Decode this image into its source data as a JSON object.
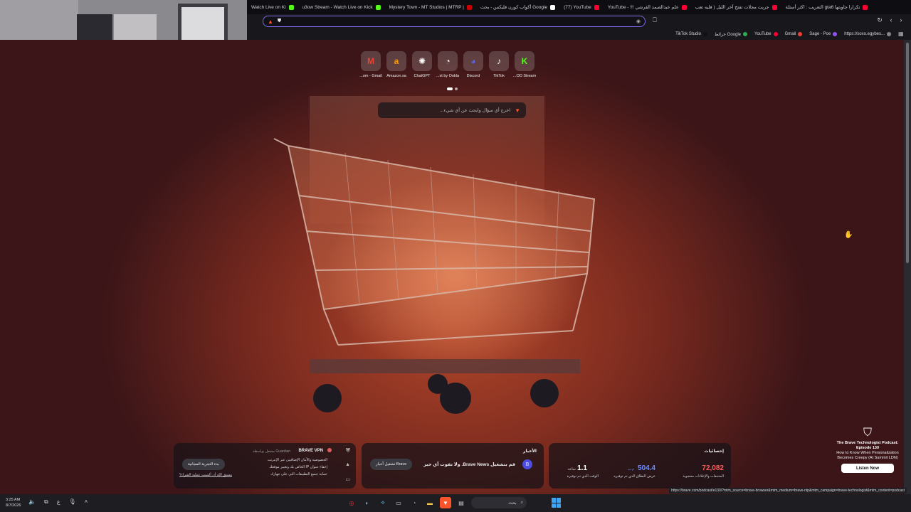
{
  "tabs": [
    {
      "title": "Watch Live on Ki",
      "color": "#53fc18"
    },
    {
      "title": "u3ow Stream - Watch Live on Kick",
      "color": "#53fc18"
    },
    {
      "title": "Mystery Town - MT Studios | MTRP |",
      "color": "#cc0000"
    },
    {
      "title": "أكواب كورن فليكس - بحث Google",
      "color": "#ffffff"
    },
    {
      "title": "(77) YouTube",
      "color": "#ff0033"
    },
    {
      "title": "YouTube - !!! علم عبدالصمد القرشي",
      "color": "#ff0033"
    },
    {
      "title": "جربت مجلات تفتح آخر الليل ( فليه تعب",
      "color": "#ff0033"
    },
    {
      "title": "التعريب : اكثر أسئلة gta6 تكرارا جاوبتها",
      "color": "#ff0033"
    }
  ],
  "address": {
    "value": ""
  },
  "bookmarks": [
    {
      "label": "TikTok Studio",
      "color": "#111111"
    },
    {
      "label": "خرائط Google",
      "color": "#34a853"
    },
    {
      "label": "YouTube",
      "color": "#ff0033"
    },
    {
      "label": "Gmail",
      "color": "#ea4335"
    },
    {
      "label": "Sage - Poe",
      "color": "#8e57f5"
    },
    {
      "label": "https://soxo.egybes...",
      "color": "#888888"
    }
  ],
  "topsites": [
    {
      "label": "...om - Gmail",
      "glyph": "M",
      "color": "#ea4335"
    },
    {
      "label": "Amazon.sa",
      "glyph": "a",
      "color": "#ff9900"
    },
    {
      "label": "ChatGPT",
      "glyph": "✺",
      "color": "#ffffff"
    },
    {
      "label": "...st by Ookla",
      "glyph": "◔",
      "color": "#ffffff"
    },
    {
      "label": "Discord",
      "glyph": "◕",
      "color": "#5865f2"
    },
    {
      "label": "TikTok",
      "glyph": "♪",
      "color": "#ffffff"
    },
    {
      "label": "...OD Stream",
      "glyph": "K",
      "color": "#53fc18"
    }
  ],
  "search": {
    "placeholder": "اخرج أي سؤال وابحث عن أي شيء..."
  },
  "vpn": {
    "title": "BRAVE VPN",
    "provider": "مشغل بواسطة Guardian",
    "items": [
      "الخصوصية والأمان الإضافيين عبر الإنترنت",
      "إخفاء عنوان IP الخاص بك وتغيير موقعك",
      "حماية جميع التطبيقات التي على جهازك"
    ],
    "cta": "بدء التجربة المجانية",
    "link": "مسبق الله أد. ألسنت عملية الشراء؟"
  },
  "news": {
    "title": "الأخبار",
    "text": "قم بتشغيل Brave News. ولا تفوت أي خبر",
    "button": "تشغيل أخبار Brave"
  },
  "stats": {
    "title": "إحصائيات",
    "trackers": {
      "value": "72,082",
      "label": "المتتبعات والإعلانات محجوبة"
    },
    "bandwidth": {
      "value": "504.4",
      "unit": "م.ب",
      "label": "عرض النطاق الذي تم توفيره"
    },
    "time": {
      "value": "1.1",
      "unit": "ساعة",
      "label": "الوقت الذي تم توفيره"
    }
  },
  "podcast": {
    "title": "The Brave Technologist Podcast: Episode 130",
    "subtitle": "How to Know When Personalization Becomes Creepy (AI Summit LDN)",
    "button": "Listen Now"
  },
  "status_url": "https://brave.com/podcast/e130/?mtm_source=brave-browser&mtm_medium=brave-ntp&mtm_campaign=brave-technologist&mtm_content=podcast",
  "taskbar": {
    "time": "3:25 AM",
    "date": "8/7/2026",
    "search_label": "بحث",
    "lang": "ع"
  },
  "colors": {
    "accent": "#7b6cf0",
    "brave": "#fb542b",
    "vpn": "#e15b5b",
    "stats_red": "#ff5b5b",
    "stats_blue": "#6b8cff"
  }
}
